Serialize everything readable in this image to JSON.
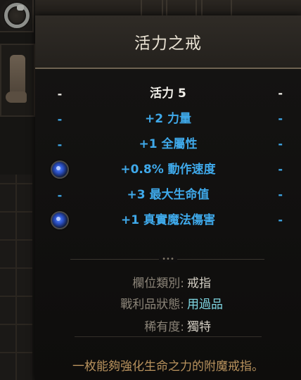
{
  "item": {
    "title": "活力之戒"
  },
  "stats": [
    {
      "left": "-",
      "text": "活力 5",
      "right": "-",
      "color": "white",
      "gem": false
    },
    {
      "left": "-",
      "text": "+2 力量",
      "right": "-",
      "color": "blue",
      "gem": false
    },
    {
      "left": "-",
      "text": "+1 全屬性",
      "right": "-",
      "color": "blue",
      "gem": false
    },
    {
      "left": "",
      "text": "+0.8% 動作速度",
      "right": "-",
      "color": "blue",
      "gem": true
    },
    {
      "left": "-",
      "text": "+3 最大生命值",
      "right": "-",
      "color": "blue",
      "gem": false
    },
    {
      "left": "",
      "text": "+1 真實魔法傷害",
      "right": "-",
      "color": "blue",
      "gem": true
    }
  ],
  "divider_dots": "•••",
  "info": {
    "slot_label": "欄位類別:",
    "slot_value": "戒指",
    "loot_label": "戰利品狀態:",
    "loot_value": "用過品",
    "rarity_label": "稀有度:",
    "rarity_value": "獨特"
  },
  "description": "一枚能夠強化生命之力的附魔戒指。",
  "colors": {
    "stat_white": "#f1efe9",
    "stat_blue": "#3fa9ea",
    "loot_value": "#7fd6e2",
    "description": "#b8925d"
  },
  "icons": {
    "equipped_ring": "ring-icon",
    "boots": "boots-icon",
    "gem_socket": "sapphire-gem-icon"
  }
}
